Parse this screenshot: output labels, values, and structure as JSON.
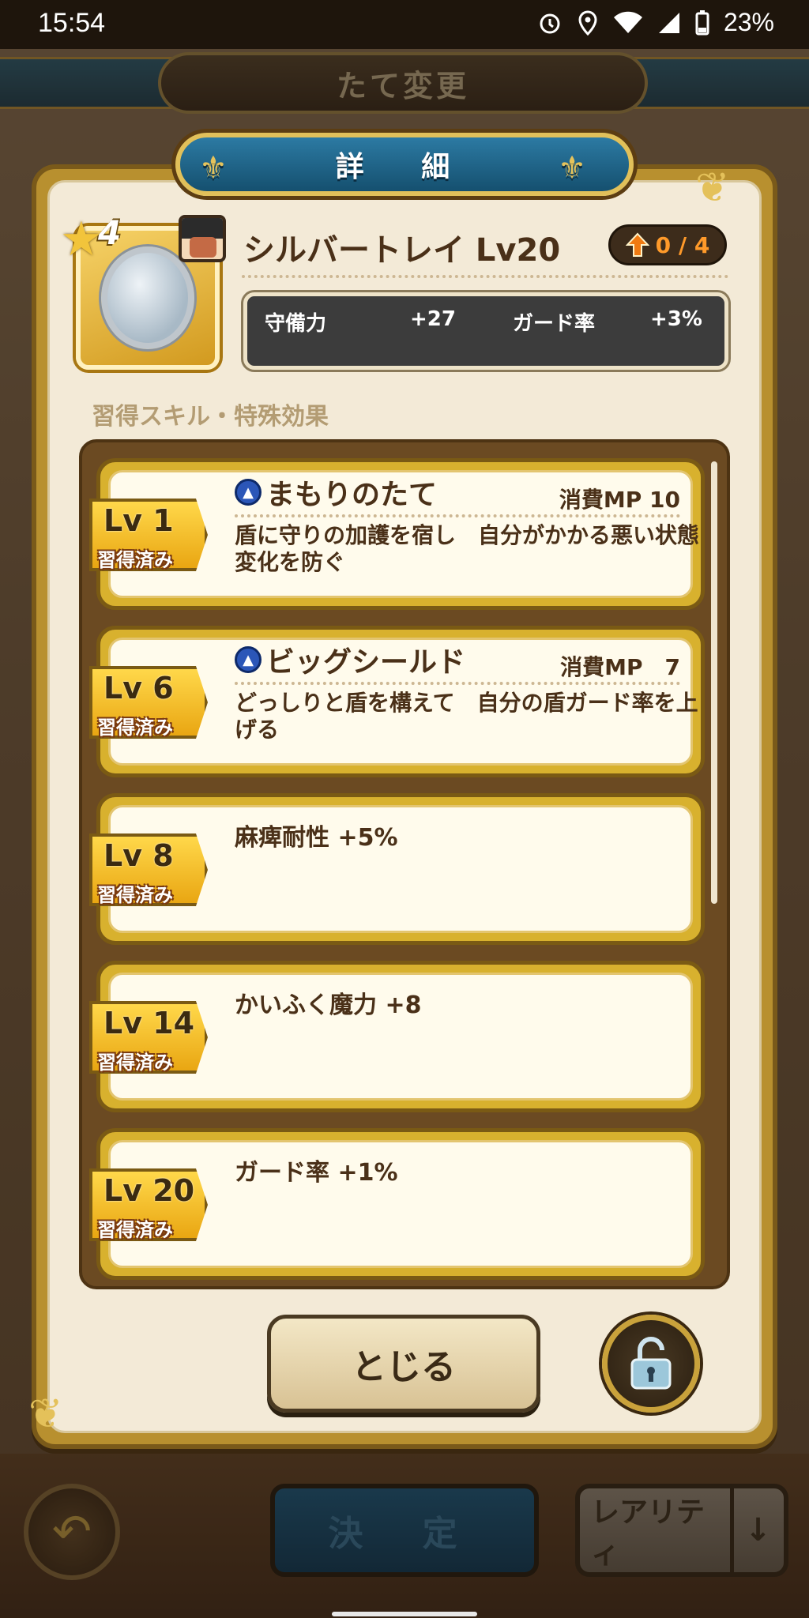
{
  "status": {
    "time": "15:54",
    "battery": "23%",
    "icons": [
      "alarm-icon",
      "location-icon",
      "wifi-icon",
      "signal-icon",
      "battery-icon"
    ]
  },
  "background": {
    "screen_title": "たて変更",
    "back_icon": "back-arrow-icon",
    "decide_label": "決 定",
    "rarity_label": "レアリティ",
    "sort_icon": "down-arrow-icon"
  },
  "dialog": {
    "title": "詳 細",
    "item": {
      "stars": "4",
      "name": "シルバートレイ Lv20",
      "upgrade": "0 / 4",
      "stats": [
        {
          "label": "守備力",
          "value": "+27"
        },
        {
          "label": "ガード率",
          "value": "+3%"
        }
      ]
    },
    "section_label": "習得スキル・特殊効果",
    "skills": [
      {
        "level": "Lv 1",
        "status": "習得済み",
        "name": "まもりのたて",
        "mp": "消費MP 10",
        "desc": "盾に守りの加護を宿し　自分がかかる悪い状態変化を防ぐ"
      },
      {
        "level": "Lv 6",
        "status": "習得済み",
        "name": "ビッグシールド",
        "mp": "消費MP　7",
        "desc": "どっしりと盾を構えて　自分の盾ガード率を上げる"
      },
      {
        "level": "Lv 8",
        "status": "習得済み",
        "effect": "麻痺耐性 +5%"
      },
      {
        "level": "Lv 14",
        "status": "習得済み",
        "effect": "かいふく魔力 +8"
      },
      {
        "level": "Lv 20",
        "status": "習得済み",
        "effect": "ガード率 +1%"
      }
    ],
    "close_label": "とじる",
    "lock_icon": "unlocked-padlock-icon"
  },
  "colors": {
    "panel_gold": "#b8902f",
    "title_blue": "#2c7aa3",
    "upgrade_orange": "#ff9a2a"
  }
}
